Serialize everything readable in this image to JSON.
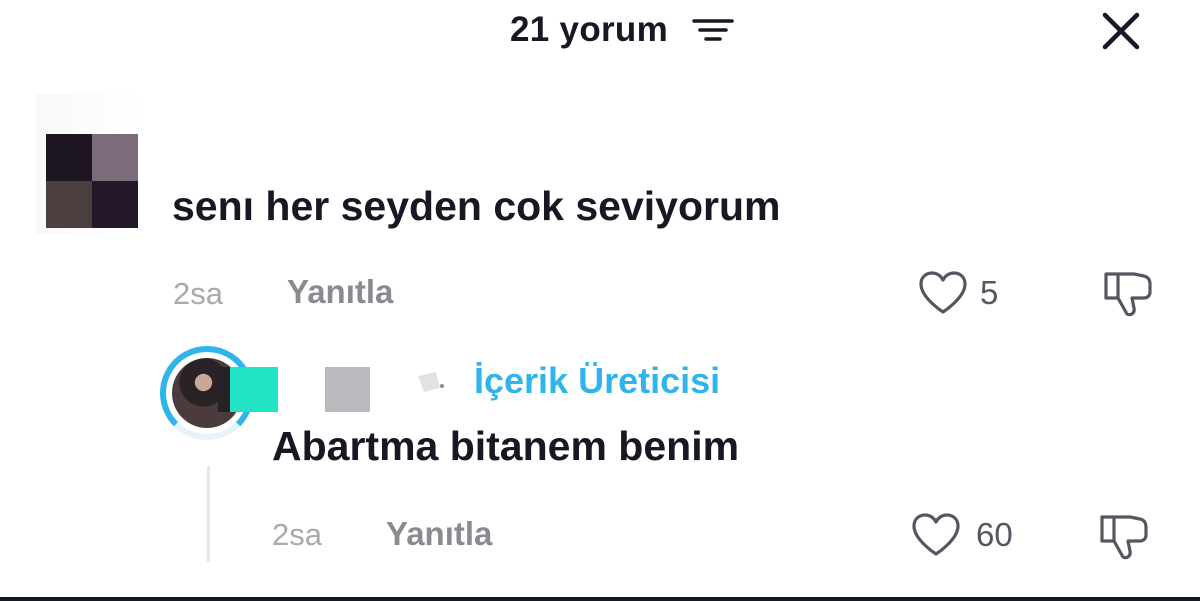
{
  "header": {
    "title": "21 yorum",
    "sort_icon": "sort-filter-icon",
    "close_icon": "close-icon"
  },
  "comments": [
    {
      "text": "senı her seyden cok seviyorum",
      "time": "2sa",
      "reply_label": "Yanıtla",
      "like_count": "5",
      "like_icon": "heart-outline-icon",
      "dislike_icon": "thumbs-down-icon"
    }
  ],
  "replies": [
    {
      "badge": "İçerik Üreticisi",
      "text": "Abartma bitanem benim",
      "time": "2sa",
      "reply_label": "Yanıtla",
      "like_count": "60",
      "like_icon": "heart-outline-icon",
      "dislike_icon": "thumbs-down-icon"
    }
  ],
  "colors": {
    "accent": "#2fb4ec",
    "text": "#161823",
    "muted": "#a8a9ad",
    "reply": "#8a8b91"
  }
}
